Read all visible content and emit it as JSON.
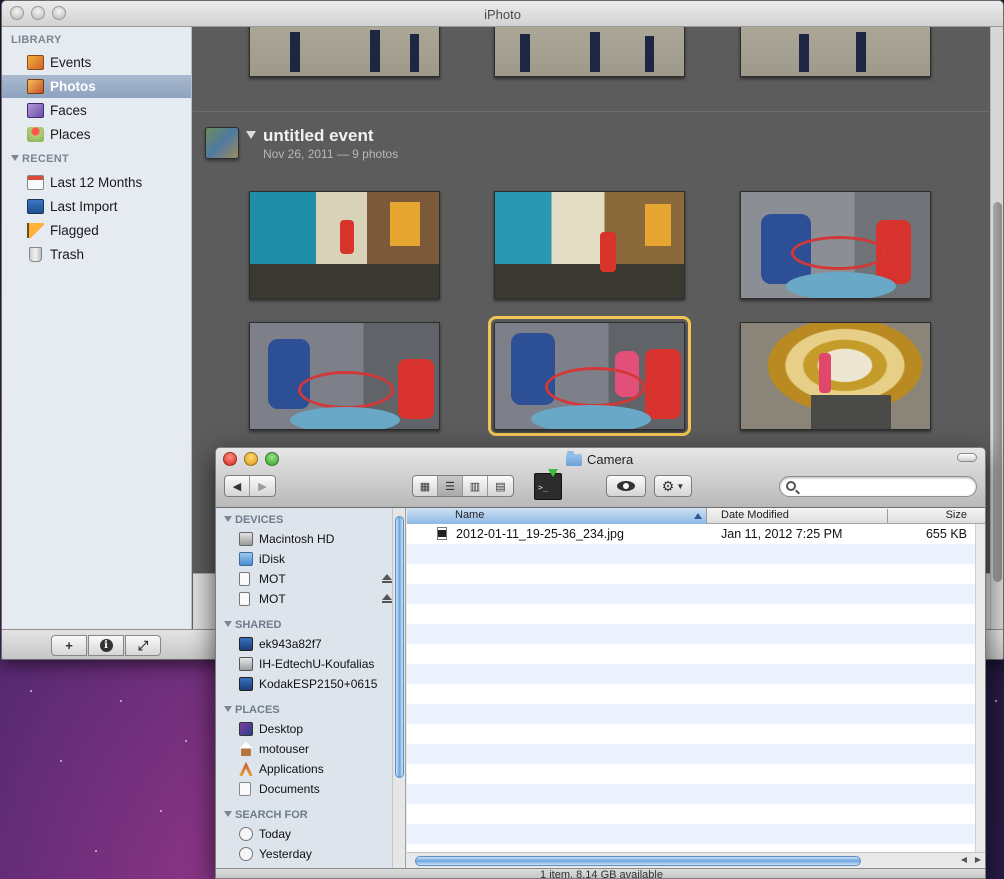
{
  "iphoto": {
    "title": "iPhoto",
    "sidebar": {
      "library_header": "LIBRARY",
      "library_items": [
        {
          "label": "Events",
          "icon": "events-icon",
          "selected": false
        },
        {
          "label": "Photos",
          "icon": "photos-icon",
          "selected": true
        },
        {
          "label": "Faces",
          "icon": "faces-icon",
          "selected": false
        },
        {
          "label": "Places",
          "icon": "places-icon",
          "selected": false
        }
      ],
      "recent_header": "RECENT",
      "recent_items": [
        {
          "label": "Last 12 Months",
          "icon": "calendar-icon"
        },
        {
          "label": "Last Import",
          "icon": "import-icon"
        },
        {
          "label": "Flagged",
          "icon": "flag-icon"
        },
        {
          "label": "Trash",
          "icon": "trash-icon"
        }
      ]
    },
    "event": {
      "title": "untitled event",
      "subtitle": "Nov 26, 2011 — 9 photos"
    },
    "bottom_toolbar": {
      "add_label": "+",
      "info_label": "i",
      "fullscreen_label": "⤢"
    }
  },
  "finder": {
    "title": "Camera",
    "search_placeholder": "",
    "sidebar": {
      "devices_header": "DEVICES",
      "devices": [
        {
          "label": "Macintosh HD",
          "icon": "hard-drive-icon",
          "eject": false
        },
        {
          "label": "iDisk",
          "icon": "idisk-icon",
          "eject": false
        },
        {
          "label": "MOT",
          "icon": "removable-disk-icon",
          "eject": true
        },
        {
          "label": "MOT",
          "icon": "removable-disk-icon",
          "eject": true
        }
      ],
      "shared_header": "SHARED",
      "shared": [
        {
          "label": "ek943a82f7",
          "icon": "network-computer-icon"
        },
        {
          "label": "IH-EdtechU-Koufalias",
          "icon": "network-computer-icon"
        },
        {
          "label": "KodakESP2150+0615",
          "icon": "network-computer-icon"
        }
      ],
      "places_header": "PLACES",
      "places": [
        {
          "label": "Desktop",
          "icon": "desktop-icon"
        },
        {
          "label": "motouser",
          "icon": "home-icon"
        },
        {
          "label": "Applications",
          "icon": "applications-icon"
        },
        {
          "label": "Documents",
          "icon": "documents-icon"
        }
      ],
      "search_header": "SEARCH FOR",
      "search_for": [
        {
          "label": "Today",
          "icon": "clock-icon"
        },
        {
          "label": "Yesterday",
          "icon": "clock-icon"
        }
      ]
    },
    "columns": {
      "name": "Name",
      "date_modified": "Date Modified",
      "size": "Size"
    },
    "files": [
      {
        "name": "2012-01-11_19-25-36_234.jpg",
        "date_modified": "Jan 11, 2012 7:25 PM",
        "size": "655 KB"
      }
    ],
    "status": "1 item, 8.14 GB available"
  }
}
